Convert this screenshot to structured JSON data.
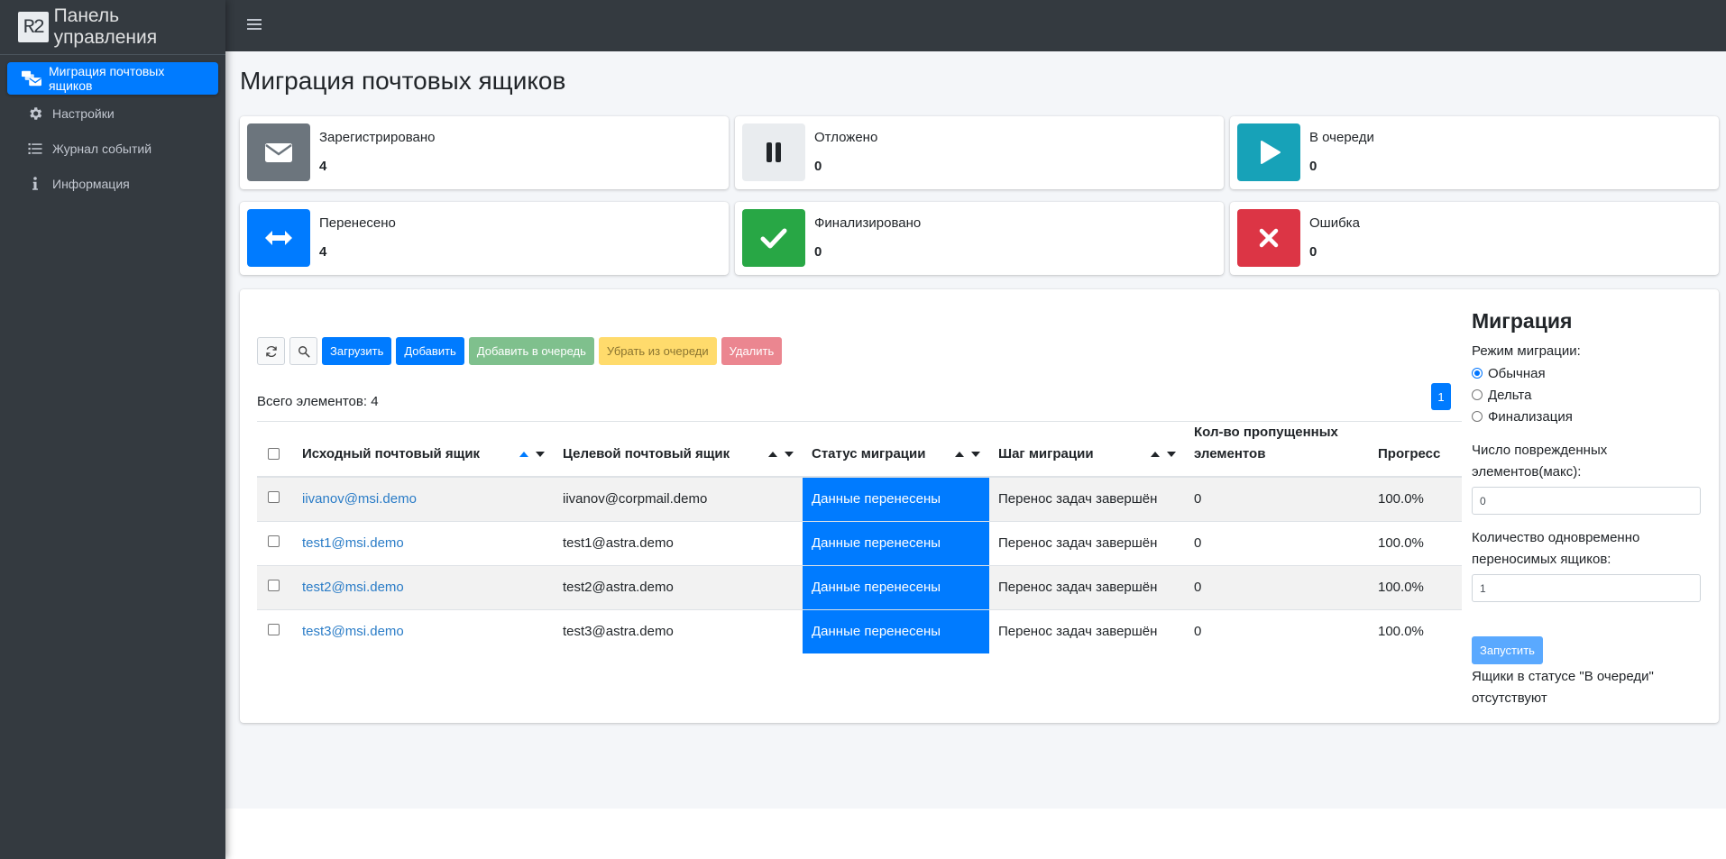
{
  "sidebar": {
    "brand_logo": "R2",
    "brand": "Панель управления",
    "items": [
      {
        "label": "Миграция почтовых ящиков",
        "icon": "mail-bulk-icon"
      },
      {
        "label": "Настройки",
        "icon": "gear-icon"
      },
      {
        "label": "Журнал событий",
        "icon": "list-icon"
      },
      {
        "label": "Информация",
        "icon": "info-icon"
      }
    ]
  },
  "page": {
    "title": "Миграция почтовых ящиков"
  },
  "stats": [
    {
      "label": "Зарегистрировано",
      "value": "4",
      "icon": "envelope-icon",
      "color": "#6c757d"
    },
    {
      "label": "Отложено",
      "value": "0",
      "icon": "pause-icon",
      "color": "#e9ecef"
    },
    {
      "label": "В очереди",
      "value": "0",
      "icon": "play-icon",
      "color": "#17a2b8"
    },
    {
      "label": "Перенесено",
      "value": "4",
      "icon": "arrows-horizontal-icon",
      "color": "#007bff"
    },
    {
      "label": "Финализировано",
      "value": "0",
      "icon": "check-icon",
      "color": "#28a745"
    },
    {
      "label": "Ошибка",
      "value": "0",
      "icon": "close-icon",
      "color": "#dc3545"
    }
  ],
  "toolbar": {
    "load": "Загрузить",
    "add": "Добавить",
    "add_queue": "Добавить в очередь",
    "remove_queue": "Убрать из очереди",
    "delete": "Удалить"
  },
  "table": {
    "total": "Всего элементов: 4",
    "page": "1",
    "columns": [
      "Исходный почтовый ящик",
      "Целевой почтовый ящик",
      "Статус миграции",
      "Шаг миграции",
      "Кол-во пропущенных элементов",
      "Прогресс"
    ],
    "rows": [
      {
        "source": "iivanov@msi.demo",
        "target": "iivanov@corpmail.demo",
        "status": "Данные перенесены",
        "step": "Перенос задач завершён",
        "skipped": "0",
        "progress": "100.0%"
      },
      {
        "source": "test1@msi.demo",
        "target": "test1@astra.demo",
        "status": "Данные перенесены",
        "step": "Перенос задач завершён",
        "skipped": "0",
        "progress": "100.0%"
      },
      {
        "source": "test2@msi.demo",
        "target": "test2@astra.demo",
        "status": "Данные перенесены",
        "step": "Перенос задач завершён",
        "skipped": "0",
        "progress": "100.0%"
      },
      {
        "source": "test3@msi.demo",
        "target": "test3@astra.demo",
        "status": "Данные перенесены",
        "step": "Перенос задач завершён",
        "skipped": "0",
        "progress": "100.0%"
      }
    ]
  },
  "migration": {
    "title": "Миграция",
    "mode_label": "Режим миграции:",
    "modes": [
      "Обычная",
      "Дельта",
      "Финализация"
    ],
    "selected_mode": "Обычная",
    "damaged_label": "Число поврежденных элементов(макс):",
    "damaged_value": "0",
    "concurrent_label": "Количество одновременно переносимых ящиков:",
    "concurrent_value": "1",
    "run": "Запустить",
    "note": "Ящики в статусе \"В очереди\" отсутствуют"
  }
}
